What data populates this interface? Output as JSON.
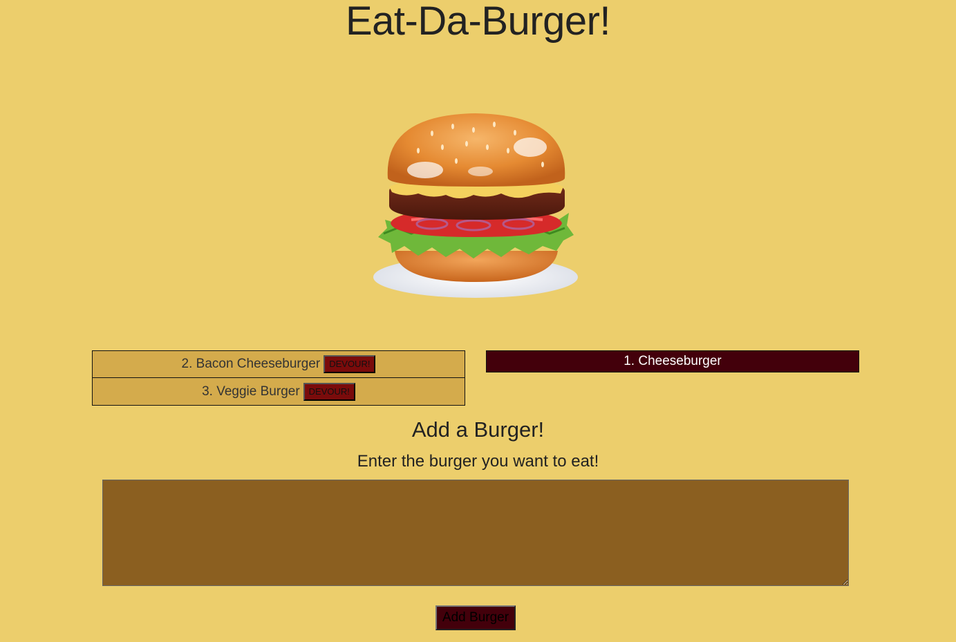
{
  "header": {
    "title": "Eat-Da-Burger!"
  },
  "hero_image": {
    "icon": "burger-illustration"
  },
  "uneaten": {
    "items": [
      {
        "label": "2. Bacon Cheeseburger",
        "button": "DEVOUR!"
      },
      {
        "label": "3. Veggie Burger",
        "button": "DEVOUR!"
      }
    ]
  },
  "eaten": {
    "items": [
      {
        "label": "1. Cheeseburger"
      }
    ]
  },
  "form": {
    "heading": "Add a Burger!",
    "label": "Enter the burger you want to eat!",
    "textarea_value": "",
    "submit_label": "Add Burger"
  },
  "colors": {
    "background": "#ecce6c",
    "uneaten_row": "#d4ab4c",
    "eaten_row": "#43000b",
    "devour_button": "#7a0b0b",
    "textarea": "#8b5f20"
  }
}
